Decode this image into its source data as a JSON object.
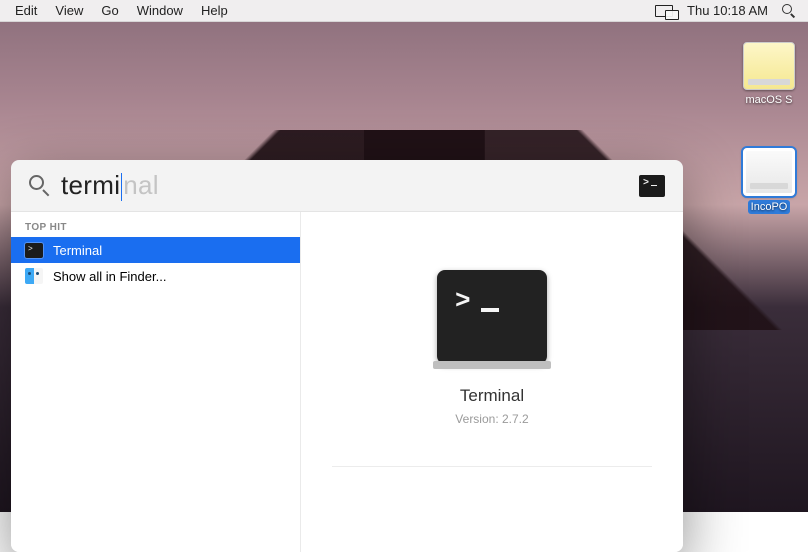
{
  "menubar": {
    "items": [
      "Edit",
      "View",
      "Go",
      "Window",
      "Help"
    ],
    "clock": "Thu 10:18 AM"
  },
  "desktop": {
    "drives": [
      {
        "label": "macOS S"
      },
      {
        "label": "IncoPO"
      }
    ]
  },
  "spotlight": {
    "query_typed": "termi",
    "query_completion": "nal",
    "section_label": "TOP HIT",
    "results": [
      {
        "label": "Terminal",
        "selected": true,
        "icon": "terminal"
      },
      {
        "label": "Show all in Finder...",
        "selected": false,
        "icon": "finder"
      }
    ],
    "preview": {
      "title": "Terminal",
      "version_label": "Version",
      "version_value": "2.7.2"
    }
  }
}
